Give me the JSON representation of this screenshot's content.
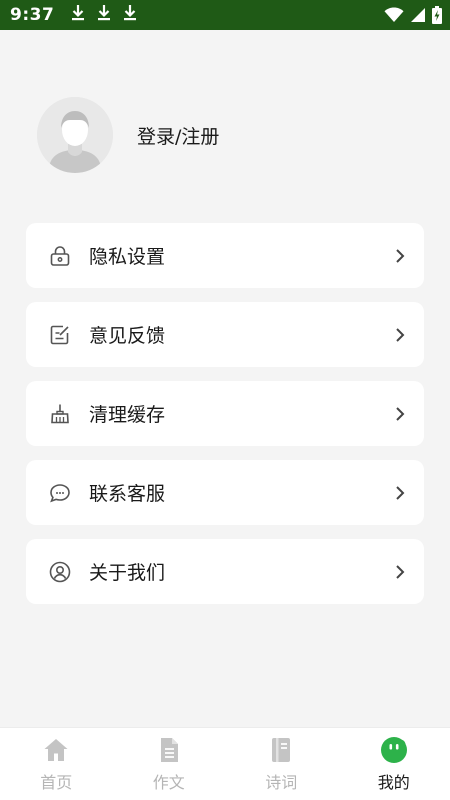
{
  "status_bar": {
    "time": "9:37",
    "icons": [
      "download-icon",
      "download-icon",
      "download-icon",
      "wifi-icon",
      "signal-icon",
      "battery-charging-icon"
    ]
  },
  "profile": {
    "login_label": "登录/注册",
    "avatar_icon": "default-avatar-icon"
  },
  "menu": {
    "items": [
      {
        "label": "隐私设置",
        "icon": "lock-icon"
      },
      {
        "label": "意见反馈",
        "icon": "feedback-edit-icon"
      },
      {
        "label": "清理缓存",
        "icon": "broom-icon"
      },
      {
        "label": "联系客服",
        "icon": "chat-bubble-icon"
      },
      {
        "label": "关于我们",
        "icon": "user-circle-icon"
      }
    ]
  },
  "bottom_nav": {
    "items": [
      {
        "label": "首页",
        "icon": "home-icon",
        "active": false
      },
      {
        "label": "作文",
        "icon": "document-icon",
        "active": false
      },
      {
        "label": "诗词",
        "icon": "book-icon",
        "active": false
      },
      {
        "label": "我的",
        "icon": "mascot-face-icon",
        "active": true
      }
    ]
  },
  "colors": {
    "status_bar_bg": "#1f5a16",
    "accent_green": "#2db24a",
    "inactive_nav": "#b5b5b5",
    "page_bg": "#f4f4f4"
  }
}
